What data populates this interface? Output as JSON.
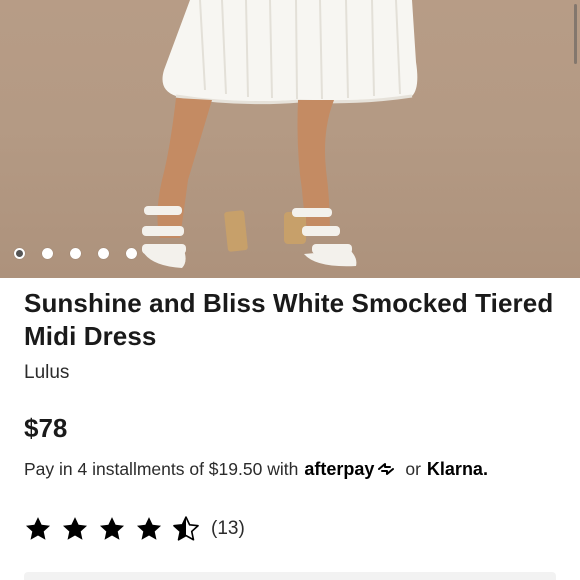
{
  "hero": {
    "image_alt": "model wearing white tiered midi dress and white strappy block-heel sandals",
    "carousel_dots": 5,
    "active_index": 0
  },
  "product": {
    "title": "Sunshine and Bliss White Smocked Tiered Midi Dress",
    "brand": "Lulus",
    "price": "$78"
  },
  "payment": {
    "text": "Pay in 4 installments of $19.50 with",
    "afterpay": "afterpay",
    "or": "or",
    "klarna": "Klarna."
  },
  "rating": {
    "value": 4.5,
    "max": 5,
    "count": "(13)"
  },
  "colors": {
    "background": "#ffffff",
    "text": "#1a1a1a",
    "backdrop": "#b49a84"
  }
}
